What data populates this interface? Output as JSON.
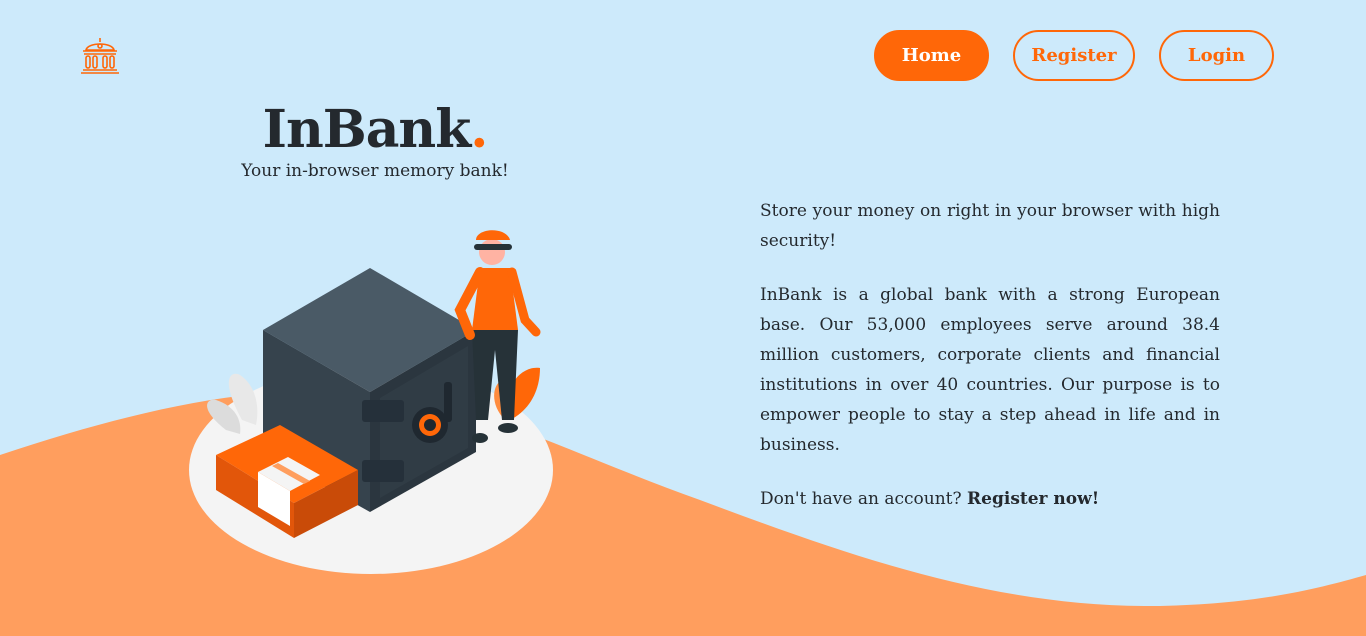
{
  "header": {
    "logo_icon": "bank-building-icon",
    "nav": {
      "home_label": "Home",
      "register_label": "Register",
      "login_label": "Login"
    }
  },
  "hero": {
    "title": "InBank",
    "title_dot": ".",
    "tagline": "Your in-browser memory bank!",
    "illustration": "safe-guard-money-illustration"
  },
  "content": {
    "intro": "Store your money on right in your browser with high security!",
    "about": "InBank is a global bank with a strong European base. Our 53,000 employees serve around 38.4 million customers, corporate clients and financial institutions in over 40 countries. Our purpose is to empower people to stay a step ahead in life and in business.",
    "cta_text": "Don't have an account?",
    "cta_link": "Register now!"
  },
  "colors": {
    "background": "#cdeafb",
    "accent": "#ff6708",
    "wave": "#ff9e5e",
    "text": "#24292e"
  }
}
